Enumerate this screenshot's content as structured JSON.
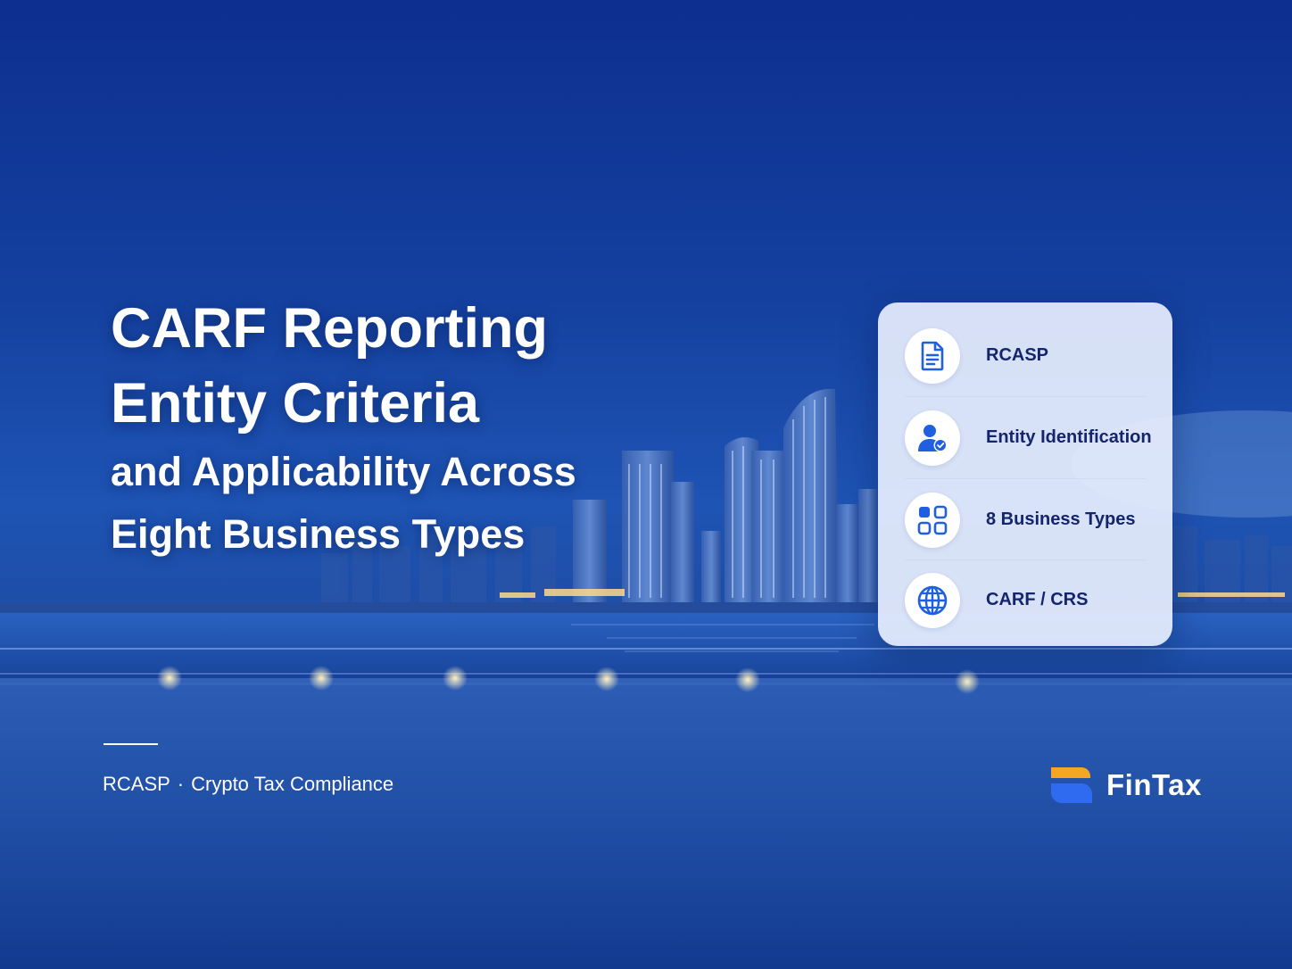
{
  "title": {
    "line1": "CARF Reporting",
    "line2": "Entity Criteria",
    "line3": "and Applicability Across",
    "line4": "Eight Business Types"
  },
  "tagline": {
    "left": "RCASP",
    "separator": "·",
    "right": "Crypto Tax Compliance"
  },
  "card": {
    "items": [
      {
        "label": "RCASP",
        "icon": "document-icon"
      },
      {
        "label": "Entity Identification",
        "icon": "user-check-icon"
      },
      {
        "label": "8 Business Types",
        "icon": "grid-icon"
      },
      {
        "label": "CARF / CRS",
        "icon": "globe-icon"
      }
    ]
  },
  "brand": {
    "name": "FinTax",
    "logo": "fintax-logo-icon"
  },
  "colors": {
    "background": "#1a4aa8",
    "card_text": "#14256e",
    "icon_blue": "#1f5fe0",
    "logo_orange": "#f5a623",
    "logo_blue": "#2f6bf0"
  }
}
